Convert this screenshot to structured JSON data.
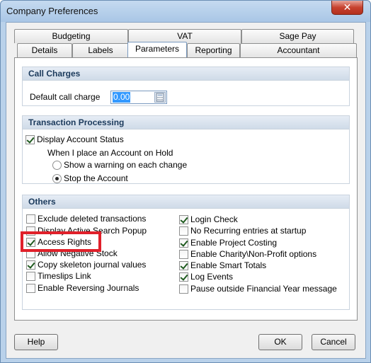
{
  "window": {
    "title": "Company Preferences",
    "close_glyph": "✕"
  },
  "tabs": {
    "top_row": [
      "Budgeting",
      "VAT",
      "Sage Pay"
    ],
    "bottom_row": [
      "Details",
      "Labels",
      "Parameters",
      "Reporting",
      "Accountant"
    ],
    "active": "Parameters"
  },
  "call_charges": {
    "heading": "Call Charges",
    "label": "Default call charge",
    "value": "0.00",
    "calculator_icon": "calculator-icon"
  },
  "transaction_processing": {
    "heading": "Transaction Processing",
    "display_account_status": {
      "label": "Display Account Status",
      "checked": true
    },
    "hold_label": "When I place an Account on Hold",
    "options": [
      {
        "label": "Show a warning on each change",
        "selected": false
      },
      {
        "label": "Stop the Account",
        "selected": true
      }
    ]
  },
  "others": {
    "heading": "Others",
    "left": [
      {
        "label": "Exclude deleted transactions",
        "checked": false
      },
      {
        "label": "Display Active Search Popup",
        "checked": false
      },
      {
        "label": "Access Rights",
        "checked": true
      },
      {
        "label": "Allow Negative Stock",
        "checked": false
      },
      {
        "label": "Copy skeleton journal values",
        "checked": true
      },
      {
        "label": "Timeslips Link",
        "checked": false
      },
      {
        "label": "Enable Reversing Journals",
        "checked": false
      }
    ],
    "right": [
      {
        "label": "Login Check",
        "checked": true
      },
      {
        "label": "No Recurring entries at startup",
        "checked": false
      },
      {
        "label": "Enable Project Costing",
        "checked": true
      },
      {
        "label": "Enable Charity\\Non-Profit options",
        "checked": false
      },
      {
        "label": "Enable Smart Totals",
        "checked": true
      },
      {
        "label": "Log Events",
        "checked": true
      },
      {
        "label": "Pause outside Financial Year message",
        "checked": false
      }
    ]
  },
  "buttons": {
    "help": "Help",
    "ok": "OK",
    "cancel": "Cancel"
  },
  "colors": {
    "highlight": "#e0202a",
    "accent": "#3399ff"
  }
}
